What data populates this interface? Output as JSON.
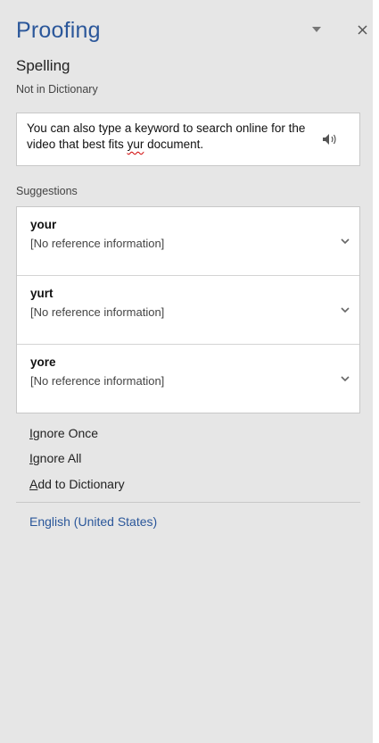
{
  "pane": {
    "title": "Proofing",
    "section_title": "Spelling",
    "subtitle": "Not in Dictionary",
    "dropdown_icon": "triangle-down-icon",
    "close_icon": "close-icon"
  },
  "context": {
    "text_before": "You can also type a keyword to search online for the video that best fits ",
    "misspelled_word": "yur",
    "text_after": " document.",
    "speaker_icon": "speaker-icon"
  },
  "suggestions": {
    "label": "Suggestions",
    "items": [
      {
        "word": "your",
        "reference": "[No reference information]"
      },
      {
        "word": "yurt",
        "reference": "[No reference information]"
      },
      {
        "word": "yore",
        "reference": "[No reference information]"
      }
    ],
    "expand_icon": "chevron-down-icon"
  },
  "actions": {
    "ignore_once": {
      "accel": "I",
      "rest": "gnore Once"
    },
    "ignore_all": {
      "accel": "I",
      "rest": "gnore All"
    },
    "add_to_dictionary": {
      "accel": "A",
      "rest": "dd to Dictionary"
    }
  },
  "language": "English (United States)",
  "colors": {
    "pane_background": "#e6e6e6",
    "accent_blue": "#2b579a",
    "spelling_error_red": "#d00000"
  }
}
